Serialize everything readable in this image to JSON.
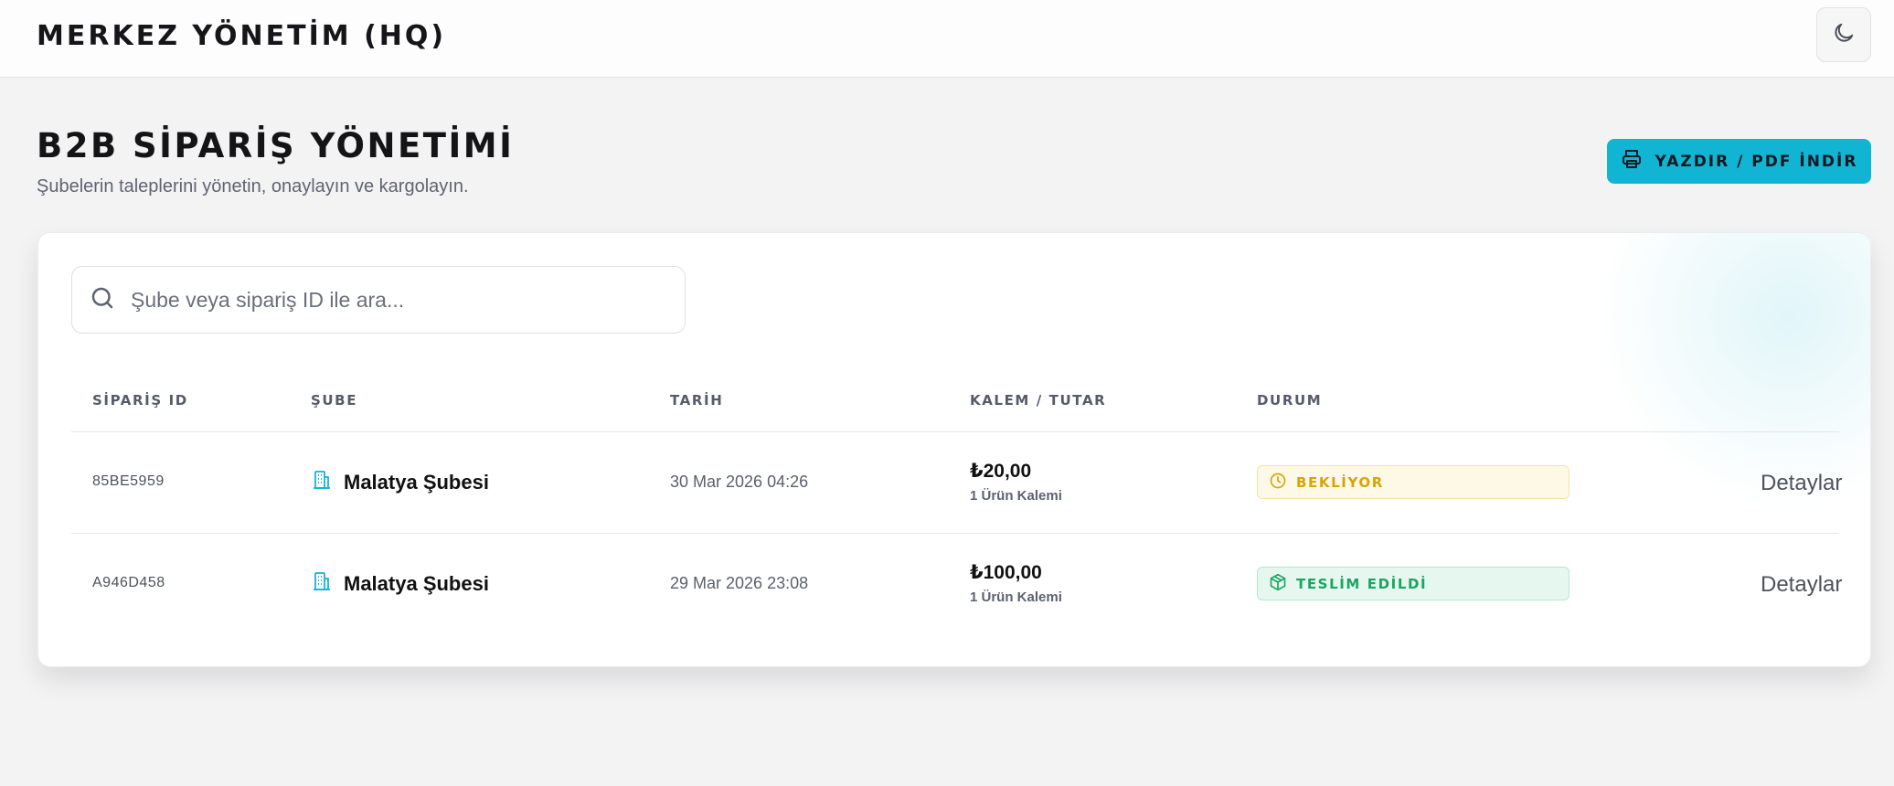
{
  "header": {
    "brand": "MERKEZ YÖNETİM (HQ)",
    "theme_toggle_icon": "moon-icon"
  },
  "page": {
    "title": "B2B SİPARİŞ YÖNETİMİ",
    "subtitle": "Şubelerin taleplerini yönetin, onaylayın ve kargolayın.",
    "print_button": "YAZDIR / PDF İNDİR"
  },
  "search": {
    "placeholder": "Şube veya sipariş ID ile ara...",
    "value": ""
  },
  "table": {
    "columns": [
      "SİPARİŞ ID",
      "ŞUBE",
      "TARİH",
      "KALEM / TUTAR",
      "DURUM"
    ],
    "rows": [
      {
        "id": "85BE5959",
        "branch": "Malatya Şubesi",
        "date": "30 Mar 2026 04:26",
        "amount": "₺20,00",
        "items": "1 Ürün Kalemi",
        "status": "BEKLİYOR",
        "status_icon": "clock-icon",
        "action": "Detaylar"
      },
      {
        "id": "A946D458",
        "branch": "Malatya Şubesi",
        "date": "29 Mar 2026 23:08",
        "amount": "₺100,00",
        "items": "1 Ürün Kalemi",
        "status": "TESLİM EDİLDİ",
        "status_icon": "package-icon",
        "action": "Detaylar"
      }
    ]
  },
  "colors": {
    "accent": "#12b4d4",
    "pending": "#d9a407",
    "delivered": "#1aa563"
  }
}
